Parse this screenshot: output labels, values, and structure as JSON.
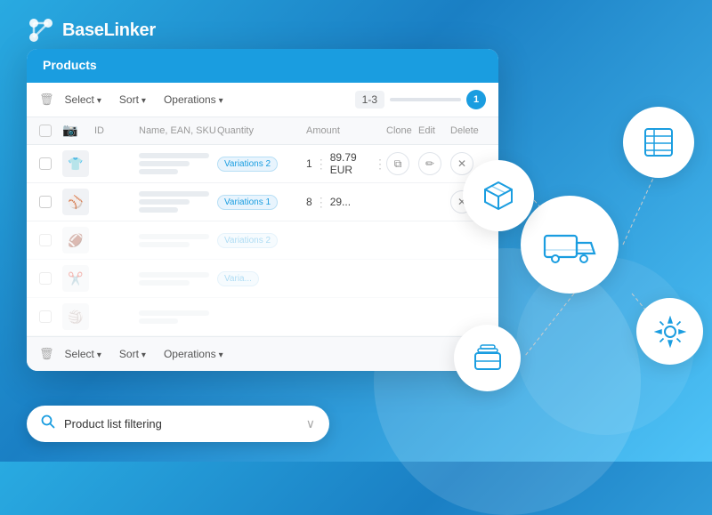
{
  "app": {
    "logo_text": "BaseLinker"
  },
  "card": {
    "header_title": "Products"
  },
  "toolbar_top": {
    "select_label": "Select",
    "sort_label": "Sort",
    "operations_label": "Operations",
    "pagination_range": "1-3",
    "page_number": "1"
  },
  "table": {
    "headers": {
      "id": "ID",
      "name_ean_sku": "Name, EAN, SKU",
      "quantity": "Quantity",
      "amount": "Amount",
      "clone": "Clone",
      "edit": "Edit",
      "delete": "Delete"
    },
    "rows": [
      {
        "id": "",
        "thumb_emoji": "👕",
        "variation": "Variations 2",
        "quantity": "1",
        "amount": "89.79 EUR",
        "faded": false
      },
      {
        "id": "",
        "thumb_emoji": "⚾",
        "variation": "Variations 1",
        "quantity": "8",
        "amount": "29...",
        "faded": false
      },
      {
        "id": "",
        "thumb_emoji": "🏈",
        "variation": "Variations 2",
        "quantity": "",
        "amount": "",
        "faded": true
      },
      {
        "id": "",
        "thumb_emoji": "✂️",
        "variation": "Varia...",
        "quantity": "",
        "amount": "",
        "faded": true
      },
      {
        "id": "",
        "thumb_emoji": "🏐",
        "variation": "",
        "quantity": "",
        "amount": "",
        "faded": true
      }
    ]
  },
  "toolbar_bottom": {
    "select_label": "Select",
    "sort_label": "Sort",
    "operations_label": "Operations"
  },
  "search": {
    "placeholder": "Product list filtering",
    "chevron": "∨"
  },
  "floating": {
    "delivery_icon": "🚚",
    "box_icon": "📦",
    "list_icon": "📋",
    "gear_icon": "⚙",
    "stack_icon": "🗂"
  }
}
